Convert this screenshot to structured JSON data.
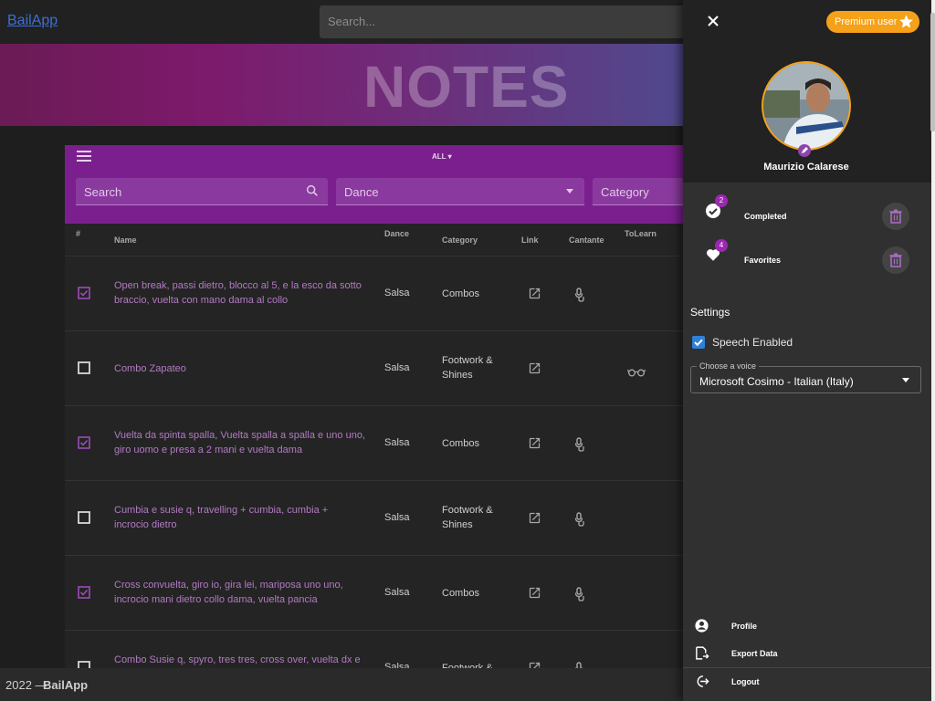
{
  "app": {
    "brand": "BailApp"
  },
  "topbar": {
    "search_placeholder": "Search..."
  },
  "banner": {
    "title": "NOTES"
  },
  "card": {
    "filter_toggle": "ALL",
    "search_label": "Search",
    "dance_label": "Dance",
    "category_label": "Category",
    "columns": {
      "num": "#",
      "name": "Name",
      "dance": "Dance",
      "category": "Category",
      "link": "Link",
      "cantante": "Cantante",
      "tolearn": "ToLearn"
    }
  },
  "rows": [
    {
      "checked": true,
      "name": "Open break, passi dietro, blocco al 5, e la esco da sotto braccio, vuelta con mano dama al collo",
      "dance": "Salsa",
      "category": "Combos",
      "cantante": true,
      "tolearn": false
    },
    {
      "checked": false,
      "name": "Combo Zapateo",
      "dance": "Salsa",
      "category": "Footwork & Shines",
      "cantante": false,
      "tolearn": true
    },
    {
      "checked": true,
      "name": "Vuelta da spinta spalla, Vuelta spalla a spalla e uno uno, giro uomo e presa a 2 mani e vuelta dama",
      "dance": "Salsa",
      "category": "Combos",
      "cantante": true,
      "tolearn": false
    },
    {
      "checked": false,
      "name": "Cumbia e susie q, travelling + cumbia, cumbia + incrocio dietro",
      "dance": "Salsa",
      "category": "Footwork & Shines",
      "cantante": true,
      "tolearn": false
    },
    {
      "checked": true,
      "name": "Cross convuelta, giro io, gira lei, mariposa uno uno, incrocio mani dietro collo dama, vuelta pancia",
      "dance": "Salsa",
      "category": "Combos",
      "cantante": true,
      "tolearn": false
    },
    {
      "checked": false,
      "name": "Combo Susie q, spyro, tres tres, cross over, vuelta dx e",
      "dance": "Salsa",
      "category": "Footwork &",
      "cantante": true,
      "tolearn": false
    }
  ],
  "footer": {
    "year": "2022 —",
    "brand": "BailApp"
  },
  "drawer": {
    "premium_label": "Premium user",
    "user_name": "Maurizio Calarese",
    "completed": {
      "label": "Completed",
      "count": "2"
    },
    "favorites": {
      "label": "Favorites",
      "count": "4"
    },
    "settings_title": "Settings",
    "speech_label": "Speech Enabled",
    "speech_enabled": true,
    "voice_legend": "Choose a voice",
    "voice_value": "Microsoft Cosimo - Italian (Italy)",
    "menu": {
      "profile": "Profile",
      "export": "Export Data",
      "logout": "Logout"
    }
  },
  "colors": {
    "accent": "#7b1f8f",
    "premium": "#f5a119",
    "link_text": "#b27ac3",
    "checkbox_blue": "#2f80d6"
  }
}
